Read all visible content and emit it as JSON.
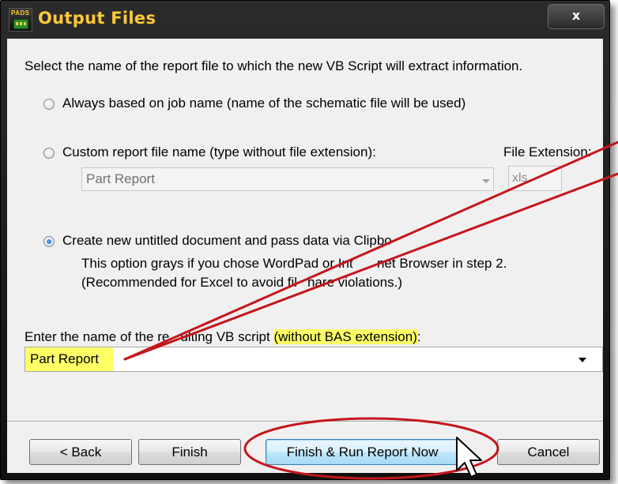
{
  "window": {
    "title": "Output Files",
    "icon_label": "PADS",
    "close_glyph": "x"
  },
  "intro_text": "Select the name of the report file to which the new VB Script will extract information.",
  "options": {
    "job_name": {
      "label": "Always based on job name (name of the schematic file will be used)",
      "checked": false
    },
    "custom": {
      "label": "Custom report file name (type without file extension):",
      "checked": false,
      "value": "Part Report",
      "extension_label": "File Extension:",
      "extension_value": "xls"
    },
    "clipboard": {
      "label": "Create new untitled document and pass data via Clipbo",
      "checked": true,
      "note_line1": "This option grays if you chose WordPad or Int",
      "note_line1_b": "net Browser in step 2.",
      "note_line2": "(Recommended for Excel to avoid fil",
      "note_line2_b": "hare violations.)"
    }
  },
  "script_name": {
    "label_part1": "Enter the name of the re",
    "label_part2": "ulting VB script ",
    "label_highlight": "(without BAS extension)",
    "label_end": ":",
    "value": "Part Report"
  },
  "buttons": {
    "back": "< Back",
    "finish": "Finish",
    "finish_run": "Finish & Run Report Now",
    "cancel": "Cancel"
  },
  "annotation": {
    "color": "#c4161c"
  },
  "colors": {
    "title_text": "#ffc938",
    "highlight": "#ffff66",
    "client_bg": "#f0f0f0"
  }
}
